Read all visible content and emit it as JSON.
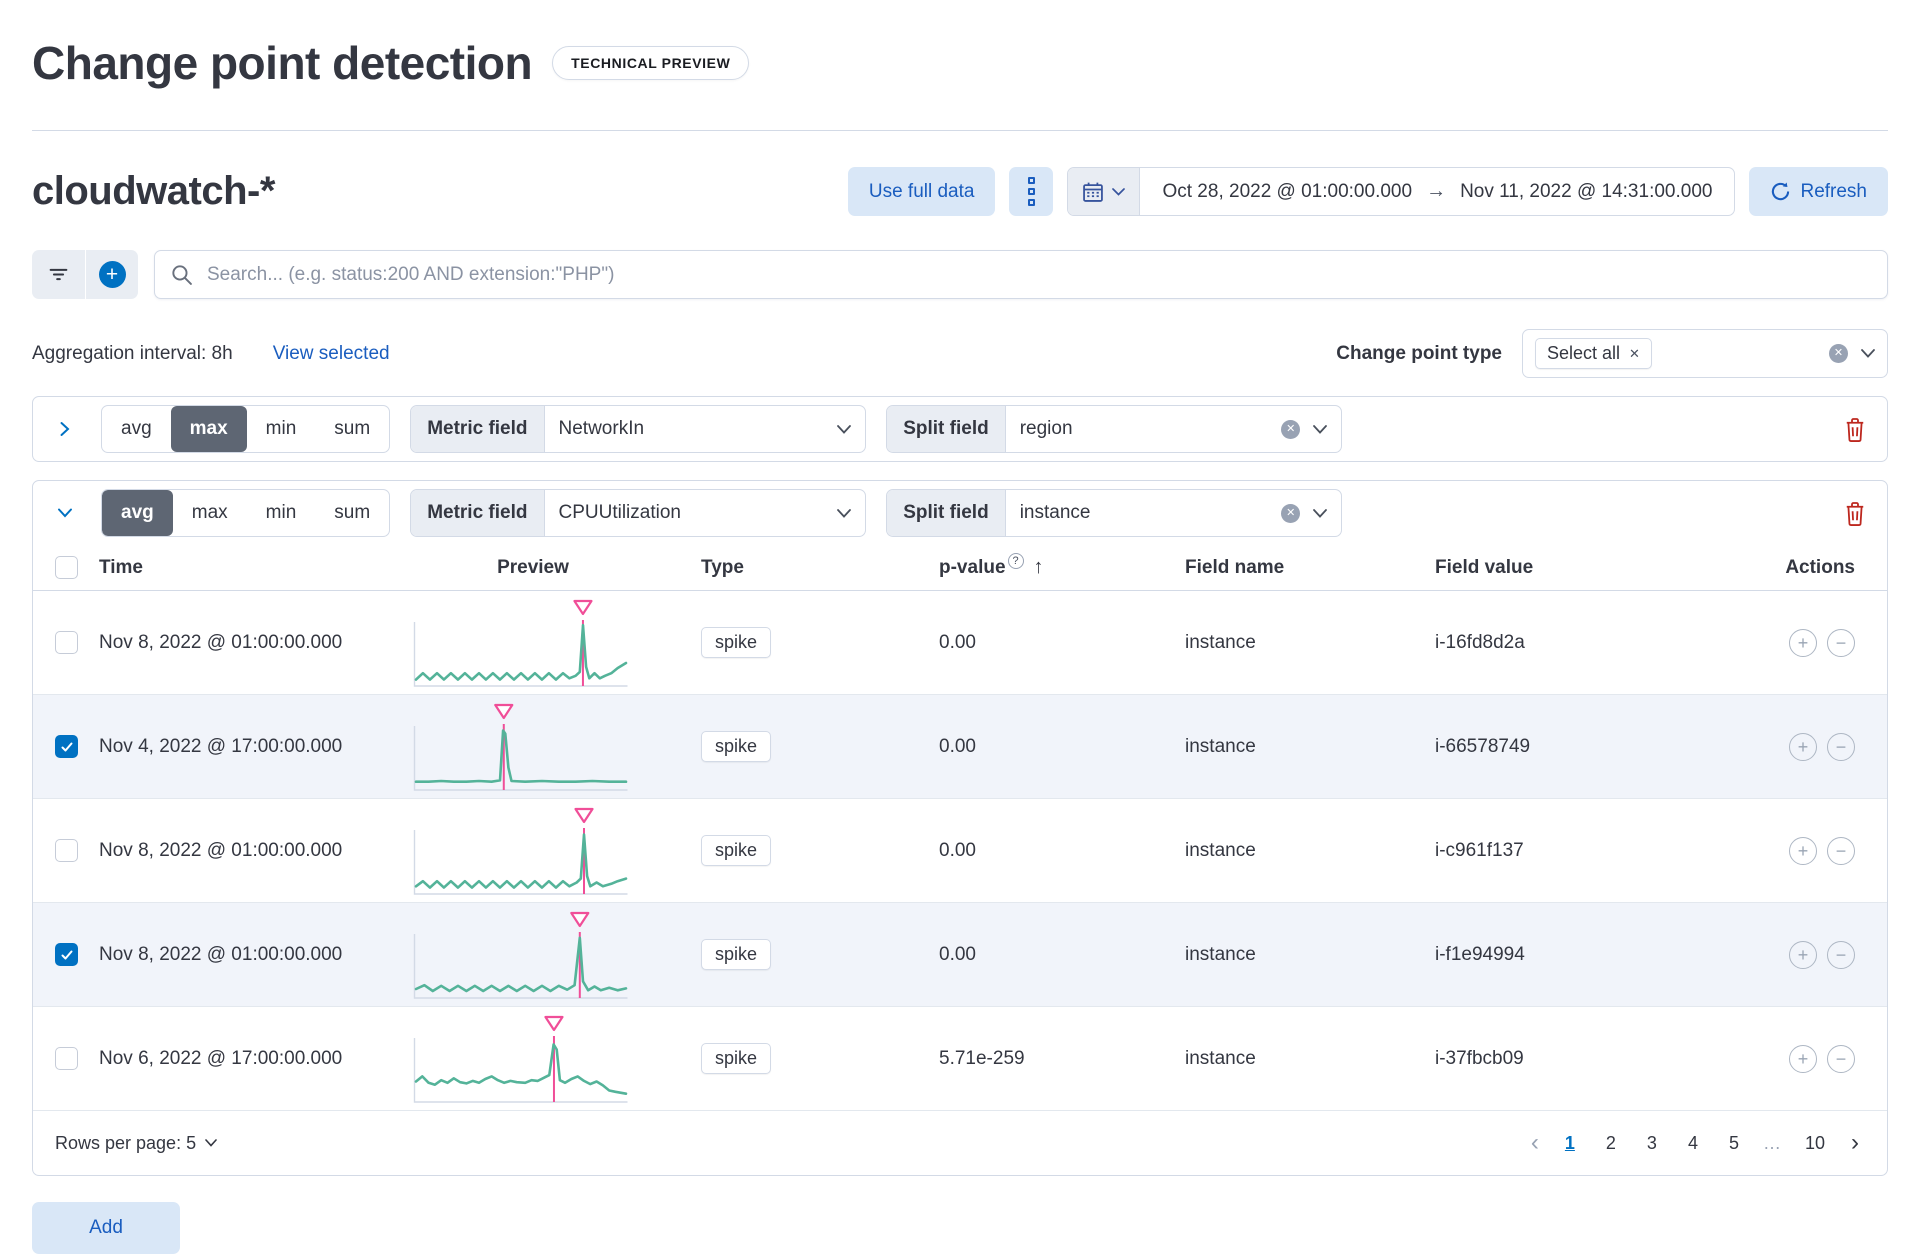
{
  "colors": {
    "accent": "#0071c2",
    "button-bg": "#d9e7f7",
    "button-text": "#1a5dbf",
    "border": "#d3dae6",
    "text": "#343741",
    "subdued": "#69707d",
    "selected-row-bg": "#f1f4fa",
    "prepend-bg": "#e9edf3",
    "segment-selected": "#5e6673",
    "danger": "#bd271e",
    "line-green": "#54b399",
    "annotation-pink": "#f04e98"
  },
  "header": {
    "title": "Change point detection",
    "badge": "TECHNICAL PREVIEW"
  },
  "index_header": {
    "title": "cloudwatch-*"
  },
  "toolbar": {
    "use_full_data_label": "Use full data",
    "date_start": "Oct 28, 2022 @ 01:00:00.000",
    "date_end": "Nov 11, 2022 @ 14:31:00.000",
    "refresh_label": "Refresh"
  },
  "search": {
    "placeholder": "Search... (e.g. status:200 AND extension:\"PHP\")"
  },
  "filters_bar": {
    "aggregation_interval": "Aggregation interval: 8h",
    "view_selected": "View selected",
    "change_point_type_label": "Change point type",
    "change_point_type_value": "Select all"
  },
  "agg_options": [
    "avg",
    "max",
    "min",
    "sum"
  ],
  "panels": [
    {
      "collapsed": true,
      "selected_agg": "max",
      "metric_field_label": "Metric field",
      "metric_field_value": "NetworkIn",
      "split_field_label": "Split field",
      "split_field_value": "region"
    },
    {
      "collapsed": false,
      "selected_agg": "avg",
      "metric_field_label": "Metric field",
      "metric_field_value": "CPUUtilization",
      "split_field_label": "Split field",
      "split_field_value": "instance"
    }
  ],
  "table": {
    "columns": {
      "time": "Time",
      "preview": "Preview",
      "type": "Type",
      "p_value": "p-value",
      "field_name": "Field name",
      "field_value": "Field value",
      "actions": "Actions"
    },
    "rows": [
      {
        "checked": false,
        "time": "Nov 8, 2022 @ 01:00:00.000",
        "type": "spike",
        "p_value": "0.00",
        "field_name": "instance",
        "field_value": "i-16fd8d2a",
        "sparkline": {
          "marker_x": 0.795,
          "points": [
            [
              0,
              0.1
            ],
            [
              0.033,
              0.2
            ],
            [
              0.066,
              0.1
            ],
            [
              0.1,
              0.2
            ],
            [
              0.133,
              0.1
            ],
            [
              0.166,
              0.2
            ],
            [
              0.2,
              0.1
            ],
            [
              0.233,
              0.2
            ],
            [
              0.266,
              0.1
            ],
            [
              0.3,
              0.2
            ],
            [
              0.333,
              0.1
            ],
            [
              0.366,
              0.2
            ],
            [
              0.4,
              0.1
            ],
            [
              0.433,
              0.2
            ],
            [
              0.466,
              0.1
            ],
            [
              0.5,
              0.2
            ],
            [
              0.533,
              0.1
            ],
            [
              0.566,
              0.2
            ],
            [
              0.6,
              0.1
            ],
            [
              0.633,
              0.2
            ],
            [
              0.666,
              0.1
            ],
            [
              0.7,
              0.2
            ],
            [
              0.73,
              0.12
            ],
            [
              0.76,
              0.16
            ],
            [
              0.78,
              0.22
            ],
            [
              0.795,
              0.95
            ],
            [
              0.81,
              0.3
            ],
            [
              0.825,
              0.12
            ],
            [
              0.85,
              0.2
            ],
            [
              0.875,
              0.12
            ],
            [
              0.9,
              0.16
            ],
            [
              0.93,
              0.2
            ],
            [
              0.96,
              0.28
            ],
            [
              1,
              0.36
            ]
          ]
        }
      },
      {
        "checked": true,
        "time": "Nov 4, 2022 @ 17:00:00.000",
        "type": "spike",
        "p_value": "0.00",
        "field_name": "instance",
        "field_value": "i-66578749",
        "sparkline": {
          "marker_x": 0.418,
          "points": [
            [
              0,
              0.13
            ],
            [
              0.06,
              0.13
            ],
            [
              0.12,
              0.14
            ],
            [
              0.18,
              0.13
            ],
            [
              0.24,
              0.13
            ],
            [
              0.3,
              0.14
            ],
            [
              0.36,
              0.13
            ],
            [
              0.4,
              0.15
            ],
            [
              0.415,
              0.93
            ],
            [
              0.425,
              0.88
            ],
            [
              0.44,
              0.35
            ],
            [
              0.455,
              0.14
            ],
            [
              0.52,
              0.13
            ],
            [
              0.6,
              0.14
            ],
            [
              0.68,
              0.13
            ],
            [
              0.76,
              0.13
            ],
            [
              0.84,
              0.14
            ],
            [
              0.92,
              0.13
            ],
            [
              1,
              0.13
            ]
          ]
        }
      },
      {
        "checked": false,
        "time": "Nov 8, 2022 @ 01:00:00.000",
        "type": "spike",
        "p_value": "0.00",
        "field_name": "instance",
        "field_value": "i-c961f137",
        "sparkline": {
          "marker_x": 0.8,
          "points": [
            [
              0,
              0.12
            ],
            [
              0.033,
              0.2
            ],
            [
              0.066,
              0.1
            ],
            [
              0.1,
              0.2
            ],
            [
              0.133,
              0.1
            ],
            [
              0.166,
              0.2
            ],
            [
              0.2,
              0.1
            ],
            [
              0.233,
              0.2
            ],
            [
              0.266,
              0.1
            ],
            [
              0.3,
              0.2
            ],
            [
              0.333,
              0.1
            ],
            [
              0.366,
              0.2
            ],
            [
              0.4,
              0.1
            ],
            [
              0.433,
              0.2
            ],
            [
              0.466,
              0.1
            ],
            [
              0.5,
              0.2
            ],
            [
              0.533,
              0.1
            ],
            [
              0.566,
              0.2
            ],
            [
              0.6,
              0.1
            ],
            [
              0.633,
              0.2
            ],
            [
              0.666,
              0.1
            ],
            [
              0.7,
              0.2
            ],
            [
              0.73,
              0.12
            ],
            [
              0.765,
              0.18
            ],
            [
              0.785,
              0.24
            ],
            [
              0.8,
              0.93
            ],
            [
              0.815,
              0.28
            ],
            [
              0.83,
              0.12
            ],
            [
              0.86,
              0.18
            ],
            [
              0.89,
              0.12
            ],
            [
              0.93,
              0.16
            ],
            [
              0.96,
              0.2
            ],
            [
              1,
              0.24
            ]
          ]
        }
      },
      {
        "checked": true,
        "time": "Nov 8, 2022 @ 01:00:00.000",
        "type": "spike",
        "p_value": "0.00",
        "field_name": "instance",
        "field_value": "i-f1e94994",
        "sparkline": {
          "marker_x": 0.78,
          "points": [
            [
              0,
              0.14
            ],
            [
              0.04,
              0.2
            ],
            [
              0.08,
              0.11
            ],
            [
              0.12,
              0.19
            ],
            [
              0.16,
              0.11
            ],
            [
              0.2,
              0.19
            ],
            [
              0.24,
              0.11
            ],
            [
              0.28,
              0.19
            ],
            [
              0.32,
              0.11
            ],
            [
              0.36,
              0.19
            ],
            [
              0.4,
              0.11
            ],
            [
              0.44,
              0.19
            ],
            [
              0.48,
              0.11
            ],
            [
              0.52,
              0.19
            ],
            [
              0.56,
              0.11
            ],
            [
              0.6,
              0.19
            ],
            [
              0.64,
              0.11
            ],
            [
              0.68,
              0.19
            ],
            [
              0.72,
              0.13
            ],
            [
              0.755,
              0.2
            ],
            [
              0.78,
              0.94
            ],
            [
              0.795,
              0.26
            ],
            [
              0.82,
              0.12
            ],
            [
              0.85,
              0.18
            ],
            [
              0.88,
              0.12
            ],
            [
              0.92,
              0.16
            ],
            [
              0.96,
              0.12
            ],
            [
              1,
              0.15
            ]
          ]
        }
      },
      {
        "checked": false,
        "time": "Nov 6, 2022 @ 17:00:00.000",
        "type": "spike",
        "p_value": "5.71e-259",
        "field_name": "instance",
        "field_value": "i-37fbcb09",
        "sparkline": {
          "marker_x": 0.657,
          "points": [
            [
              0,
              0.32
            ],
            [
              0.03,
              0.4
            ],
            [
              0.06,
              0.3
            ],
            [
              0.09,
              0.27
            ],
            [
              0.12,
              0.34
            ],
            [
              0.15,
              0.3
            ],
            [
              0.18,
              0.37
            ],
            [
              0.21,
              0.31
            ],
            [
              0.24,
              0.29
            ],
            [
              0.27,
              0.33
            ],
            [
              0.3,
              0.3
            ],
            [
              0.33,
              0.36
            ],
            [
              0.36,
              0.4
            ],
            [
              0.39,
              0.34
            ],
            [
              0.42,
              0.3
            ],
            [
              0.45,
              0.33
            ],
            [
              0.48,
              0.31
            ],
            [
              0.52,
              0.3
            ],
            [
              0.55,
              0.34
            ],
            [
              0.58,
              0.33
            ],
            [
              0.61,
              0.38
            ],
            [
              0.635,
              0.42
            ],
            [
              0.655,
              0.9
            ],
            [
              0.67,
              0.82
            ],
            [
              0.685,
              0.34
            ],
            [
              0.71,
              0.3
            ],
            [
              0.74,
              0.36
            ],
            [
              0.77,
              0.4
            ],
            [
              0.8,
              0.33
            ],
            [
              0.83,
              0.28
            ],
            [
              0.86,
              0.32
            ],
            [
              0.89,
              0.26
            ],
            [
              0.92,
              0.18
            ],
            [
              0.95,
              0.16
            ],
            [
              1,
              0.13
            ]
          ]
        }
      }
    ]
  },
  "pagination": {
    "rows_per_page_label": "Rows per page: 5",
    "prev": "‹",
    "next": "›",
    "pages": [
      "1",
      "2",
      "3",
      "4",
      "5",
      "…",
      "10"
    ],
    "active_page": "1"
  },
  "footer": {
    "add_label": "Add"
  }
}
